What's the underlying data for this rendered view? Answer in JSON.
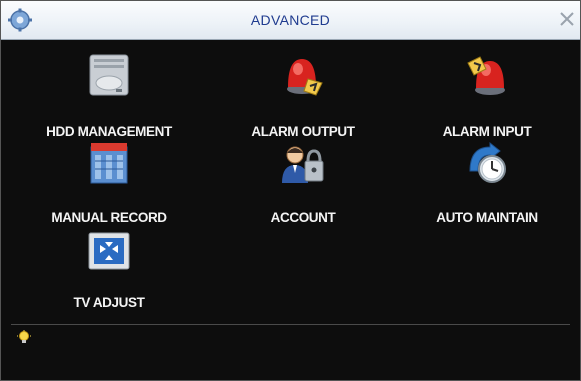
{
  "window": {
    "title": "ADVANCED"
  },
  "menu": {
    "items": [
      {
        "label": "HDD MANAGEMENT",
        "icon": "hdd-icon"
      },
      {
        "label": "ALARM OUTPUT",
        "icon": "alarm-output-icon"
      },
      {
        "label": "ALARM INPUT",
        "icon": "alarm-input-icon"
      },
      {
        "label": "MANUAL RECORD",
        "icon": "manual-record-icon"
      },
      {
        "label": "ACCOUNT",
        "icon": "account-icon"
      },
      {
        "label": "AUTO MAINTAIN",
        "icon": "auto-maintain-icon"
      },
      {
        "label": "TV ADJUST",
        "icon": "tv-adjust-icon"
      }
    ]
  },
  "status": {
    "hint_icon": "lightbulb-icon",
    "text": ""
  },
  "colors": {
    "title_text": "#1f3b8f",
    "background": "#0d0d0d",
    "label_text": "#f4f4f4"
  }
}
